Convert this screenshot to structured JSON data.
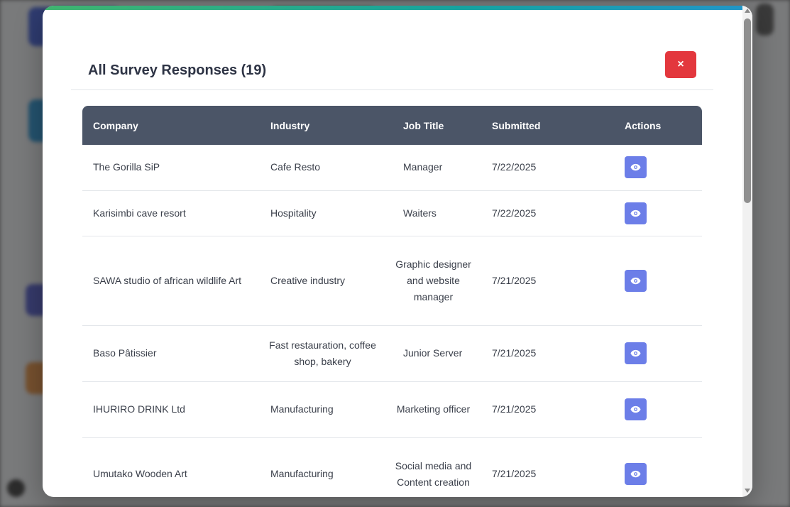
{
  "modal": {
    "title": "All Survey Responses (19)",
    "close_label": "×"
  },
  "table": {
    "headers": {
      "company": "Company",
      "industry": "Industry",
      "job_title": "Job Title",
      "submitted": "Submitted",
      "actions": "Actions"
    },
    "rows": [
      {
        "company": "The Gorilla SiP",
        "industry": "Cafe Resto",
        "job_title": "Manager",
        "submitted": "7/22/2025"
      },
      {
        "company": "Karisimbi cave resort",
        "industry": "Hospitality",
        "job_title": "Waiters",
        "submitted": "7/22/2025"
      },
      {
        "company": "SAWA studio of african wildlife Art",
        "industry": "Creative industry",
        "job_title": "Graphic designer and website manager",
        "submitted": "7/21/2025"
      },
      {
        "company": "Baso Pâtissier",
        "industry": "Fast restauration, coffee shop, bakery",
        "job_title": "Junior Server",
        "submitted": "7/21/2025"
      },
      {
        "company": "IHURIRO DRINK Ltd",
        "industry": "Manufacturing",
        "job_title": "Marketing officer",
        "submitted": "7/21/2025"
      },
      {
        "company": "Umutako Wooden Art",
        "industry": "Manufacturing",
        "job_title": "Social media and Content creation",
        "submitted": "7/21/2025"
      }
    ],
    "action_icon": "eye-icon"
  },
  "colors": {
    "header_bg": "#4b5567",
    "close_button": "#e3373d",
    "view_button": "#6c7ee8",
    "accent_bar": "#16a3a0"
  }
}
